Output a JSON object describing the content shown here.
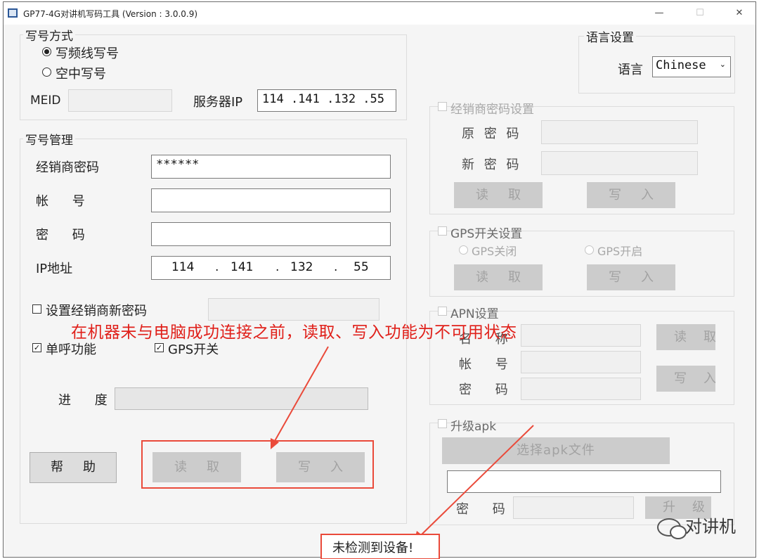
{
  "window": {
    "title": "GP77-4G对讲机写码工具 (Version : 3.0.0.9)",
    "controls": {
      "minimize": "—",
      "maximize": "☐",
      "close": "✕"
    }
  },
  "write_mode": {
    "title": "写号方式",
    "option_cable": "写频线写号",
    "option_ota": "空中写号",
    "selected": "写频线写号",
    "meid_label": "MEID",
    "meid_value": "",
    "server_ip_label": "服务器IP",
    "server_ip_value": "114 .141 .132 .55"
  },
  "language": {
    "title": "语言设置",
    "label": "语言",
    "value": "Chinese"
  },
  "management": {
    "title": "写号管理",
    "dealer_pwd_label": "经销商密码",
    "dealer_pwd_value": "******",
    "account_label": "帐 号",
    "account_value": "",
    "password_label": "密 码",
    "password_value": "",
    "ip_label": "IP地址",
    "ip_parts": [
      "114",
      "141",
      "132",
      "55"
    ],
    "ip_dot": ".",
    "set_new_pwd_label": "设置经销商新密码",
    "set_new_pwd_checked": false,
    "single_call_label": "单呼功能",
    "single_call_checked": true,
    "gps_label": "GPS开关",
    "gps_checked": true,
    "progress_label": "进 度",
    "progress_value": 0,
    "help_button": "帮助",
    "read_button": "读取",
    "write_button": "写入"
  },
  "dealer_pwd_settings": {
    "title": "经销商密码设置",
    "old_pwd_label": "原 密 码",
    "new_pwd_label": "新 密 码",
    "read_button": "读取",
    "write_button": "写入"
  },
  "gps_settings": {
    "title": "GPS开关设置",
    "off_label": "GPS关闭",
    "on_label": "GPS开启",
    "read_button": "读取",
    "write_button": "写入"
  },
  "apn_settings": {
    "title": "APN设置",
    "name_label": "名 称",
    "account_label": "帐 号",
    "password_label": "密 码",
    "read_button": "读取",
    "write_button": "写入"
  },
  "apk_upgrade": {
    "title": "升级apk",
    "choose_button": "选择apk文件",
    "path_value": "",
    "password_label": "密 码",
    "upgrade_button": "升级"
  },
  "annotation": {
    "text": "在机器未与电脑成功连接之前，读取、写入功能为不可用状态",
    "status": "未检测到设备!"
  },
  "watermark": {
    "text": "对讲机"
  },
  "colors": {
    "annotation_red": "#e0201a",
    "disabled_button": "#cccccc"
  }
}
